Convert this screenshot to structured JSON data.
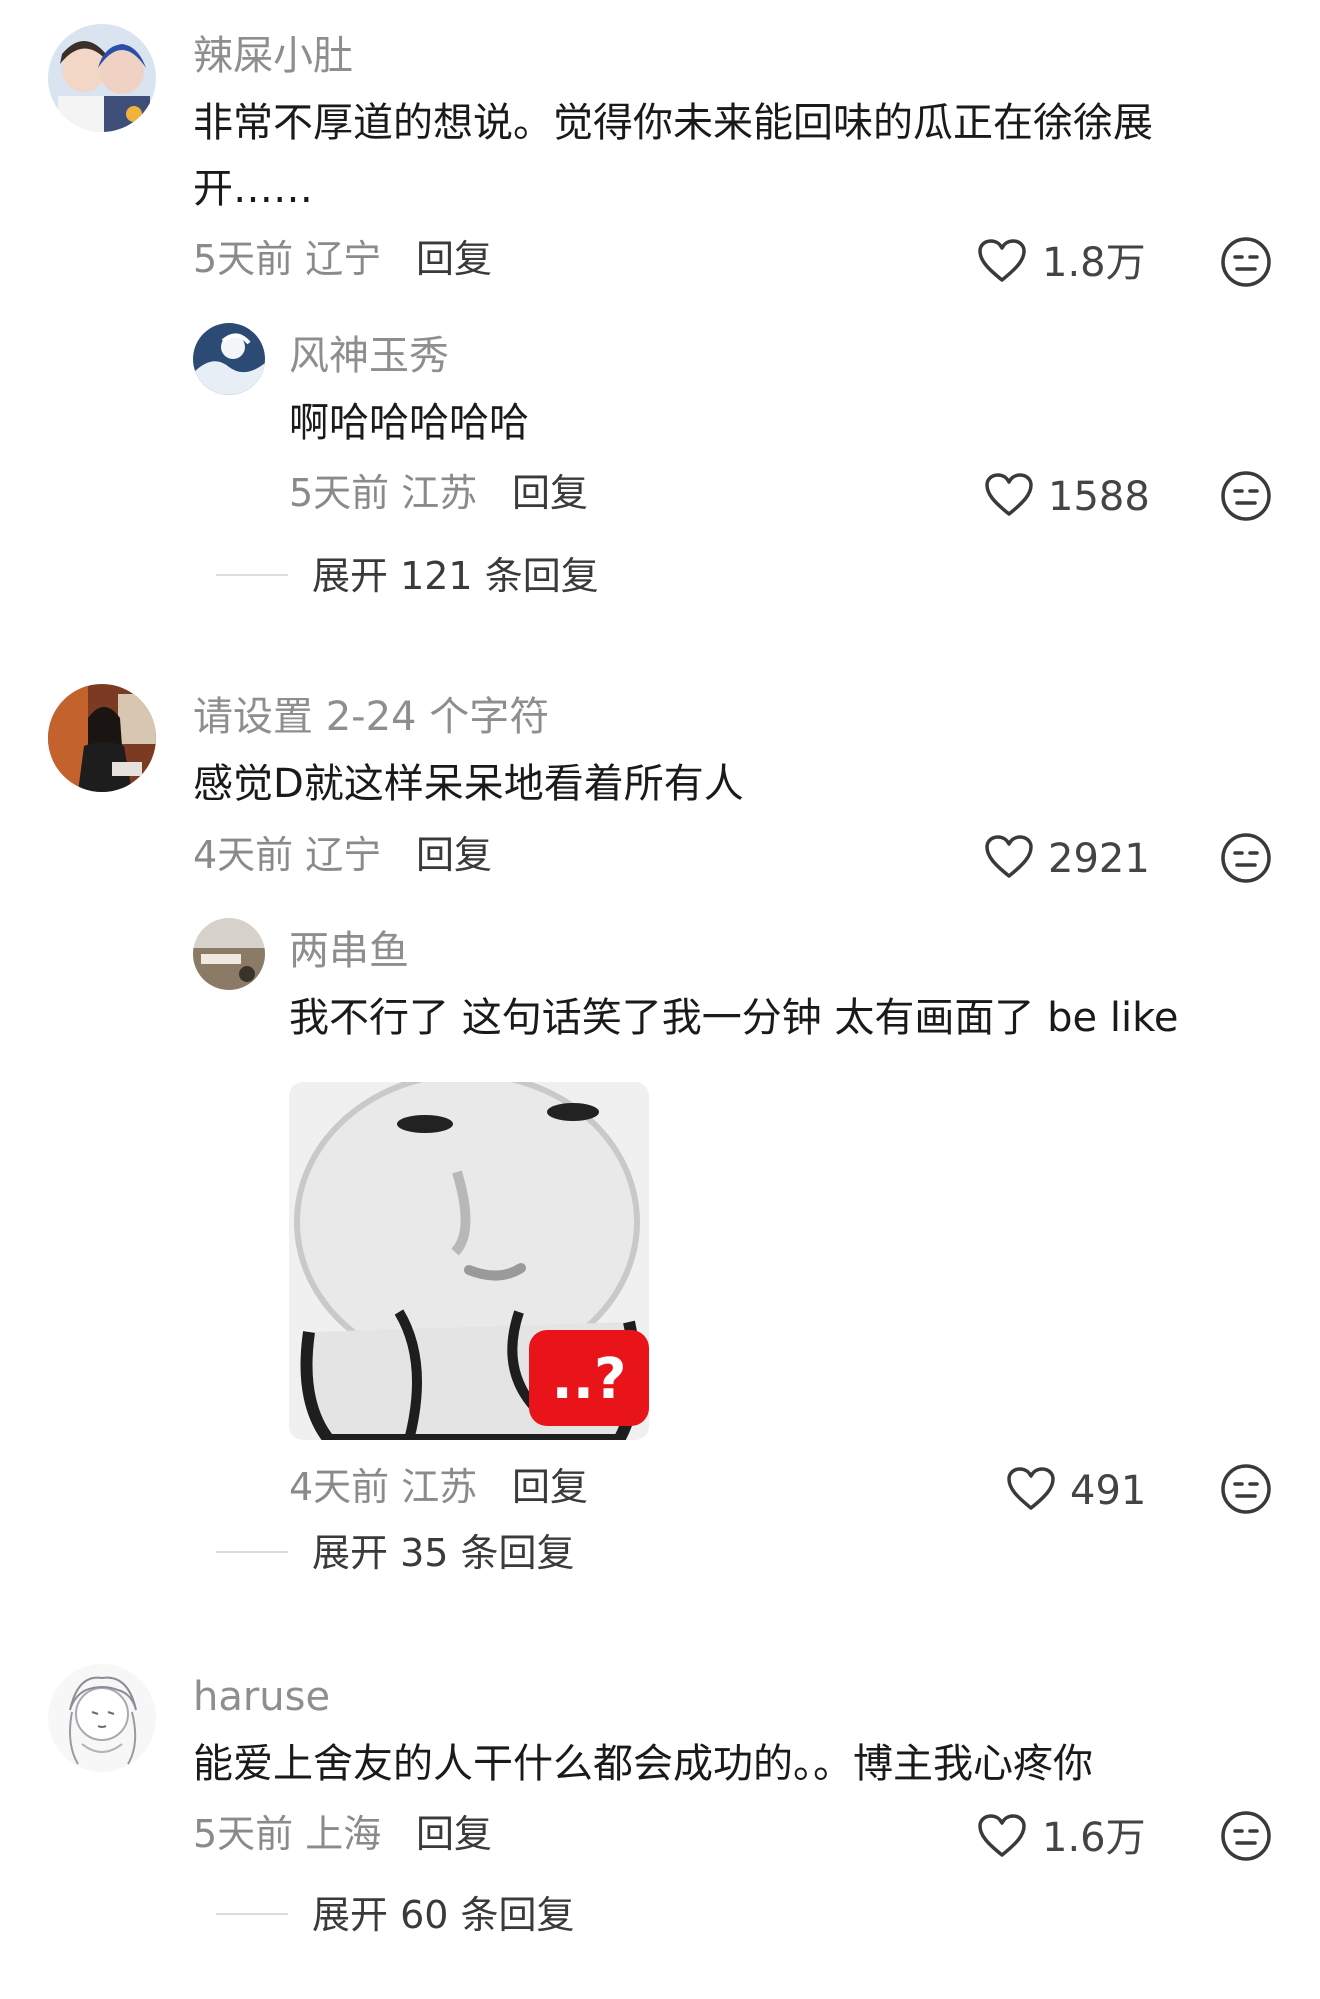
{
  "comments": [
    {
      "username": "辣屎小肚",
      "text": "非常不厚道的想说。觉得你未来能回味的瓜正在徐徐展开……",
      "time_location": "5天前 辽宁",
      "reply_label": "回复",
      "likes": "1.8万",
      "reply": {
        "username": "风神玉秀",
        "text": "啊哈哈哈哈哈",
        "time_location": "5天前 江苏",
        "reply_label": "回复",
        "likes": "1588"
      },
      "expand_label": "展开 121 条回复"
    },
    {
      "username": "请设置 2-24 个字符",
      "text": "感觉D就这样呆呆地看着所有人",
      "time_location": "4天前 辽宁",
      "reply_label": "回复",
      "likes": "2921",
      "reply": {
        "username": "两串鱼",
        "text": "我不行了 这句话笑了我一分钟 太有画面了 be like",
        "sticker_badge": "..?",
        "time_location": "4天前 江苏",
        "reply_label": "回复",
        "likes": "491"
      },
      "expand_label": "展开 35 条回复"
    },
    {
      "username": "haruse",
      "text": "能爱上舍友的人干什么都会成功的。。博主我心疼你",
      "time_location": "5天前 上海",
      "reply_label": "回复",
      "likes": "1.6万",
      "expand_label": "展开 60 条回复"
    }
  ],
  "icons": {
    "like": "heart-outline-icon",
    "dislike": "meh-face-icon"
  },
  "colors": {
    "username": "#8e8e8e",
    "text": "#1a1a1a",
    "meta": "#8a8a8a",
    "sticker_badge": "#e8141a"
  }
}
